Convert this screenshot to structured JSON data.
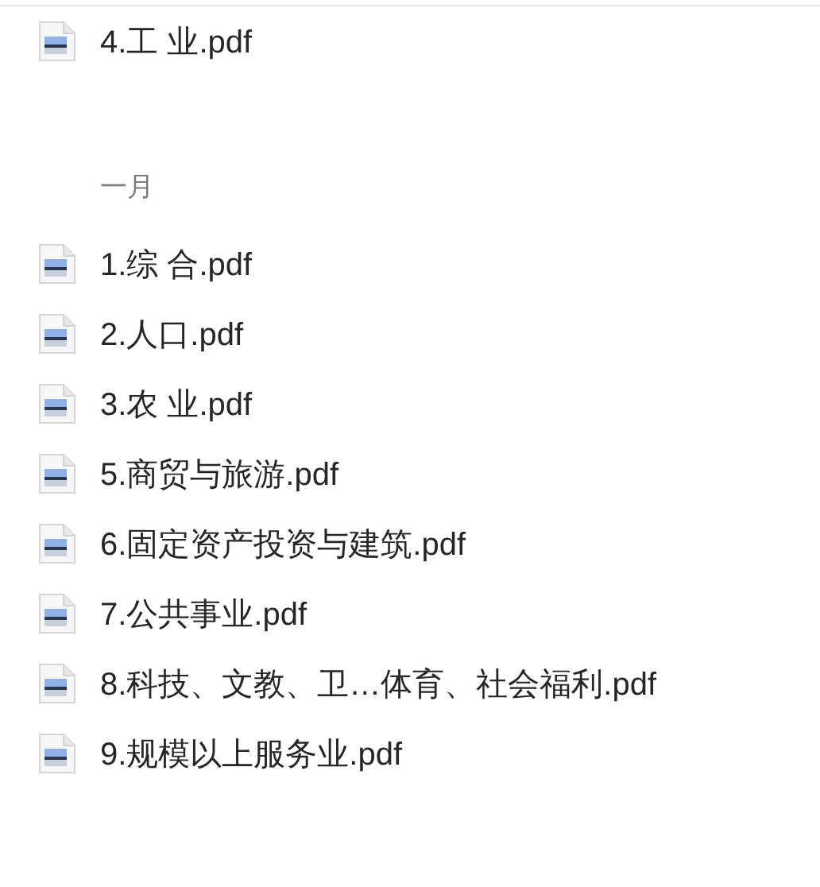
{
  "groups": [
    {
      "files": [
        {
          "name": "4.工 业.pdf"
        }
      ]
    },
    {
      "heading": "一月",
      "files": [
        {
          "name": "1.综 合.pdf"
        },
        {
          "name": "2.人口.pdf"
        },
        {
          "name": "3.农 业.pdf"
        },
        {
          "name": "5.商贸与旅游.pdf"
        },
        {
          "name": "6.固定资产投资与建筑.pdf"
        },
        {
          "name": "7.公共事业.pdf"
        },
        {
          "name": "8.科技、文教、卫…体育、社会福利.pdf"
        },
        {
          "name": "9.规模以上服务业.pdf"
        }
      ]
    }
  ]
}
